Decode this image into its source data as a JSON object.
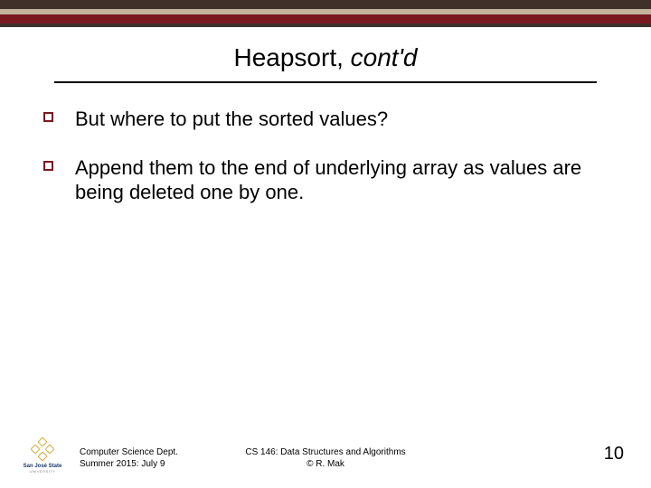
{
  "title": {
    "main": "Heapsort, ",
    "italic": "cont'd"
  },
  "bullets": [
    "But where to put the sorted values?",
    "Append them to the end of underlying array as values are being deleted one by one."
  ],
  "footer": {
    "logo_name": "San José State",
    "logo_sub": "UNIVERSITY",
    "left_line1": "Computer Science Dept.",
    "left_line2": "Summer 2015: July 9",
    "center_line1": "CS 146: Data Structures and Algorithms",
    "center_line2": "© R. Mak",
    "page": "10"
  }
}
